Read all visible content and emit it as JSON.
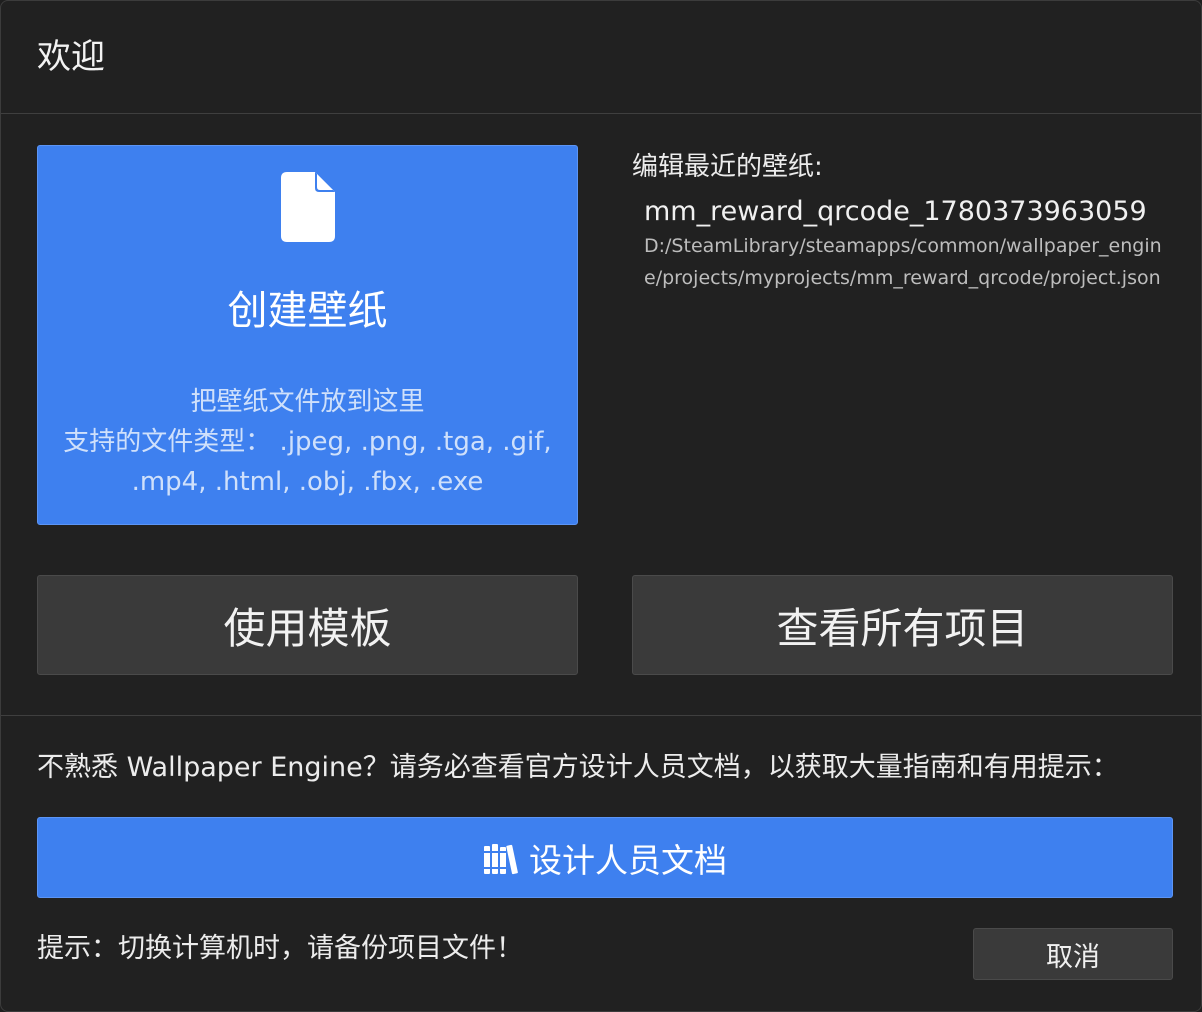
{
  "dialog": {
    "title": "欢迎"
  },
  "create": {
    "icon": "file-icon",
    "label": "创建壁纸",
    "drop_hint": "把壁纸文件放到这里",
    "supported_line1": "支持的文件类型： .jpeg, .png, .tga, .gif,",
    "supported_line2": ".mp4, .html, .obj, .fbx, .exe"
  },
  "recent": {
    "heading": "编辑最近的壁纸:",
    "items": [
      {
        "name": "mm_reward_qrcode_1780373963059",
        "path": "D:/SteamLibrary/steamapps/common/wallpaper_engine/projects/myprojects/mm_reward_qrcode/project.json"
      }
    ]
  },
  "buttons": {
    "use_template": "使用模板",
    "view_all": "查看所有项目",
    "docs": "设计人员文档",
    "docs_icon": "books-icon",
    "cancel": "取消"
  },
  "help": {
    "text": "不熟悉 Wallpaper Engine？请务必查看官方设计人员文档，以获取大量指南和有用提示：",
    "tip": "提示：切换计算机时，请备份项目文件！"
  },
  "colors": {
    "accent": "#3e80ef",
    "background": "#212121",
    "button": "#3a3a3a"
  }
}
